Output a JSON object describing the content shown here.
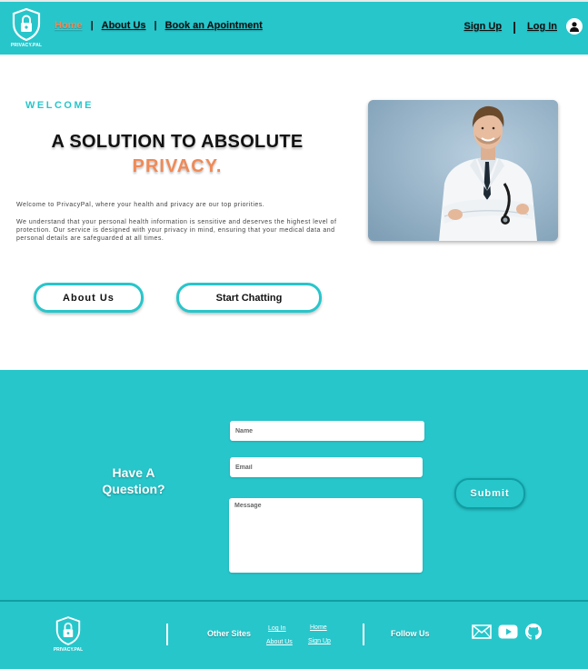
{
  "header": {
    "brand": "PRIVACY.PAL",
    "nav": [
      {
        "label": "Home",
        "active": true
      },
      {
        "label": "About Us",
        "active": false
      },
      {
        "label": "Book an Apointment",
        "active": false
      }
    ],
    "sign_up": "Sign Up",
    "log_in": "Log In",
    "separator": "|"
  },
  "hero": {
    "eyebrow": "WELCOME",
    "headline_line1": "A SOLUTION TO ABSOLUTE",
    "headline_line2": "PRIVACY.",
    "intro": "Welcome to PrivacyPal, where your health and privacy are our top priorities.",
    "body": "We understand that your personal health information is sensitive and deserves the highest level of protection. Our service  is designed with your privacy in mind, ensuring that your medical data and personal details are safeguarded at all times.",
    "about_button": "About Us",
    "chat_button": "Start Chatting"
  },
  "question": {
    "title": "Have A Question?",
    "name_placeholder": "Name",
    "email_placeholder": "Email",
    "message_placeholder": "Message",
    "submit": "Submit"
  },
  "footer": {
    "brand": "PRIVACY.PAL",
    "other_sites": "Other Sites",
    "links": {
      "log_in": "Log In",
      "about_us": "About Us",
      "home": "Home",
      "sign_up": "Sign Up"
    },
    "follow_us": "Follow Us",
    "social_icons": [
      "mail-icon",
      "youtube-icon",
      "github-icon"
    ]
  },
  "colors": {
    "primary": "#27c6cb",
    "accent": "#f08a57"
  }
}
